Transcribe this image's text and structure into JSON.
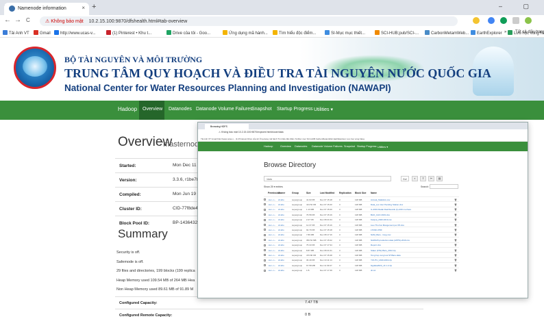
{
  "browser": {
    "tab_title": "Namenode information",
    "tab_close": "×",
    "new_tab": "+",
    "window_controls": "– ▢",
    "back": "←",
    "forward": "→",
    "reload": "C",
    "url_warning": "⚠ Không bảo mật",
    "url": "10.2.15.100:9870/dfshealth.html#tab-overview",
    "bookmarks": [
      {
        "label": "Tải Anh VT",
        "color": "#3b7dd8"
      },
      {
        "label": "Gmail",
        "color": "#d93025"
      },
      {
        "label": "http://www.ucas-v...",
        "color": "#1a73e8"
      },
      {
        "label": "(1) Pinterest • Khu t...",
        "color": "#c8232c"
      },
      {
        "label": "Drive của tôi - Goo...",
        "color": "#1fa463"
      },
      {
        "label": "Ứng dụng mã hành...",
        "color": "#f4b400"
      },
      {
        "label": "Tìm hiểu độc điểm...",
        "color": "#f4b400"
      },
      {
        "label": "SI-Mục mục thiết...",
        "color": "#3f8de0"
      },
      {
        "label": "SCI-HUB;pub/SCI-...",
        "color": "#f08a00"
      },
      {
        "label": "CarbonMetamWeb...",
        "color": "#4a8cc7"
      },
      {
        "label": "EarthExplorer",
        "color": "#3f8de0"
      },
      {
        "label": "Lưu học vùng hàng",
        "color": "#2a9d5c"
      }
    ],
    "bookmarks_more": "»",
    "other_bookmarks": "Tất cả dấu trang"
  },
  "banner": {
    "line1": "BỘ TÀI NGUYÊN VÀ MÔI TRƯỜNG",
    "line2": "TRUNG TÂM QUY HOẠCH VÀ ĐIỀU TRA TÀI NGUYÊN NƯỚC QUỐC GIA",
    "line3": "National Center for Water Resources Planning and Investigation (NAWAPI)"
  },
  "nav": {
    "brand": "Hadoop",
    "items": [
      "Overview",
      "Datanodes",
      "Datanode Volume Failures",
      "Snapshot",
      "Startup Progress",
      "Utilities ▾"
    ]
  },
  "overview": {
    "title": "Overview",
    "subtitle": "'masternode",
    "rows": [
      {
        "key": "Started:",
        "value": "Mon Dec 11 11"
      },
      {
        "key": "Version:",
        "value": "3.3.6, r1be782"
      },
      {
        "key": "Compiled:",
        "value": "Mon Jun 19 06"
      },
      {
        "key": "Cluster ID:",
        "value": "CID-77f8de4"
      },
      {
        "key": "Block Pool ID:",
        "value": "BP-143643244"
      }
    ]
  },
  "summary": {
    "title": "Summary",
    "lines": [
      "Security is off.",
      "Safemode is off.",
      "29 files and directories, 199 blocks (199 replica",
      "Heap Memory used 109.54 MB of 264 MB Hea",
      "Non Heap Memory used 89.61 MB of 91.89 M"
    ],
    "capacity": [
      {
        "key": "Configured Capacity:",
        "value": "7.47 TB"
      },
      {
        "key": "Configured Remote Capacity:",
        "value": "0 B"
      }
    ]
  },
  "overlay": {
    "tab_title": "Browsing HDFS",
    "url": "⚠ Không bảo mật   10.2.15.100:9870/explorer.html#/user/data",
    "bookmarks": "Tải Anh VT   Gmail   http://www.ucas-v...   (1) Pinterest   Drive của tôi   Ứng dụng mã hành   Tìm hiểu độc điểm   SI-Mục mục   SCI-HUB   CarbonMetamWeb   EarthExplorer   Lưu học vùng hàng",
    "nav": [
      "Hadoop",
      "Overview",
      "Datanodes",
      "Datanode Volume Failures",
      "Snapshot",
      "Startup Progress",
      "Utilities ▾"
    ],
    "browse_title": "Browse Directory",
    "path_value": "/data",
    "go": "Go!",
    "show_label": "Show  25  ▾ entries",
    "search_label": "Search:",
    "headers": [
      "Permission",
      "Owner",
      "Group",
      "Size",
      "Last Modified",
      "Replication",
      "Block Size",
      "Name"
    ],
    "rows": [
      {
        "perm": "-rw-r--r--",
        "owner": "dr.who",
        "group": "supergroup",
        "size": "41.93 KB",
        "mod": "Dec 07 15:18",
        "rep": "3",
        "bs": "128 MB",
        "name": "Annual_Statistics.csv"
      },
      {
        "perm": "-rw-r--r--",
        "owner": "dr.who",
        "group": "supergroup",
        "size": "413.52 KB",
        "mod": "Dec 07 15:20",
        "rep": "3",
        "bs": "128 MB",
        "name": "Data_Lon Hoc Pending Station.xlsx"
      },
      {
        "perm": "-rw-r--r--",
        "owner": "dr.who",
        "group": "supergroup",
        "size": "1.13 MB",
        "mod": "Dec 07 15:20",
        "rep": "3",
        "bs": "128 MB",
        "name": "IL-2019 Radar.Dashboards (1)-200 mo.there"
      },
      {
        "perm": "-rw-r--r--",
        "owner": "dr.who",
        "group": "supergroup",
        "size": "76.58 KB",
        "mod": "Dec 07 15:19",
        "rep": "3",
        "bs": "128 MB",
        "name": "BAO_CAO.2019.xlsx"
      },
      {
        "perm": "-rw-r--r--",
        "owner": "dr.who",
        "group": "supergroup",
        "size": "2.27 KB",
        "mod": "Dec 08 21:04",
        "rep": "3",
        "bs": "128 MB",
        "name": "Ketqua_2020.2019.csv"
      },
      {
        "perm": "-rw-r--r--",
        "owner": "dr.who",
        "group": "supergroup",
        "size": "12.37 KB",
        "mod": "Dec 07 15:16",
        "rep": "3",
        "bs": "128 MB",
        "name": "Lieu Thu Ket Mangement per 05.xlsx"
      },
      {
        "perm": "-rw-r--r--",
        "owner": "dr.who",
        "group": "supergroup",
        "size": "94.79 KB",
        "mod": "Dec 07 15:18",
        "rep": "3",
        "bs": "128 MB",
        "name": "LT2021.PDF"
      },
      {
        "perm": "-rw-r--r--",
        "owner": "dr.who",
        "group": "supergroup",
        "size": "7.86 MB",
        "mod": "Dec 08 17:16",
        "rep": "3",
        "bs": "128 MB",
        "name": "NAM_Baro - Copy.csv"
      },
      {
        "perm": "-rw-r--r--",
        "owner": "dr.who",
        "group": "supergroup",
        "size": "356.52 MB",
        "mod": "Dec 07 15:22",
        "rep": "3",
        "bs": "128 MB",
        "name": "NAWAPI.production.data (APPS)-2019.csv"
      },
      {
        "perm": "-rw-r--r--",
        "owner": "dr.who",
        "group": "supergroup",
        "size": "75.33 KB",
        "mod": "Dec 07 17:34",
        "rep": "3",
        "bs": "128 MB",
        "name": "Report.xlsx"
      },
      {
        "perm": "-rw-r--r--",
        "owner": "dr.who",
        "group": "supergroup",
        "size": "8.87 MB",
        "mod": "Dec 08 21:01",
        "rep": "3",
        "bs": "128 MB",
        "name": "Stater (FTE) Baro_2012.zip"
      },
      {
        "perm": "-rw-r--r--",
        "owner": "dr.who",
        "group": "supergroup",
        "size": "476.86 KB",
        "mod": "Dec 07 15:48",
        "rep": "3",
        "bs": "128 MB",
        "name": "Tong hop xung luoi NT.Bare.data"
      },
      {
        "perm": "-rw-r--r--",
        "owner": "dr.who",
        "group": "supergroup",
        "size": "36.49 KB",
        "mod": "Dec 10 11:14",
        "rep": "3",
        "bs": "128 MB",
        "name": "YOUTU_2019.2019.zip"
      },
      {
        "perm": "-rw-r--r--",
        "owner": "dr.who",
        "group": "supergroup",
        "size": "67.58 MB",
        "mod": "Dec 11 09:47",
        "rep": "3",
        "bs": "128 MB",
        "name": "bigdata2023_v4.1.2.zip"
      },
      {
        "perm": "-rw-r--r--",
        "owner": "dr.who",
        "group": "supergroup",
        "size": "1 B",
        "mod": "Dec 07 17:49",
        "rep": "3",
        "bs": "128 MB",
        "name": "dn.txt"
      }
    ],
    "delete_icon": "🗑"
  }
}
